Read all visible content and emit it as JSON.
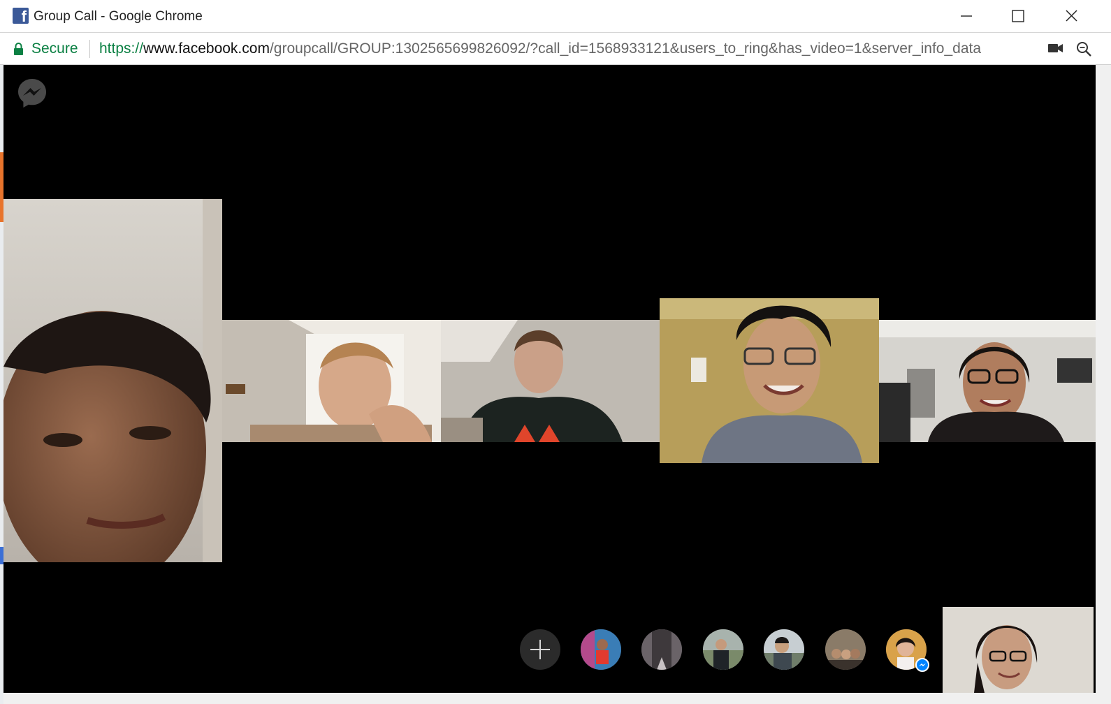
{
  "window": {
    "title": "Group Call - Google Chrome",
    "favicon": "facebook-icon",
    "controls": [
      "minimize-icon",
      "maximize-icon",
      "close-icon"
    ]
  },
  "address_bar": {
    "secure_label": "Secure",
    "url_scheme": "https://",
    "url_host": "www.facebook.com",
    "url_path": "/groupcall/GROUP:1302565699826092/?call_id=1568933121&users_to_ring&has_video=1&server_info_data",
    "icons": [
      "lock-icon",
      "camera-icon",
      "zoom-icon"
    ]
  },
  "call": {
    "logo_icon": "messenger-icon",
    "background": "#000000",
    "video_tiles": [
      "participant-video-1",
      "participant-video-2",
      "participant-video-3",
      "participant-video-4",
      "participant-video-5"
    ],
    "strip": {
      "add_icon": "plus-icon",
      "avatars": [
        "participant-avatar-1",
        "participant-avatar-2",
        "participant-avatar-3",
        "participant-avatar-4",
        "participant-avatar-5",
        "participant-avatar-6"
      ],
      "next_label": "⟩",
      "self_view": "self-view-video"
    }
  },
  "colors": {
    "secure_green": "#0b8043",
    "facebook_blue": "#3b5998",
    "messenger_blue": "#0084ff"
  }
}
